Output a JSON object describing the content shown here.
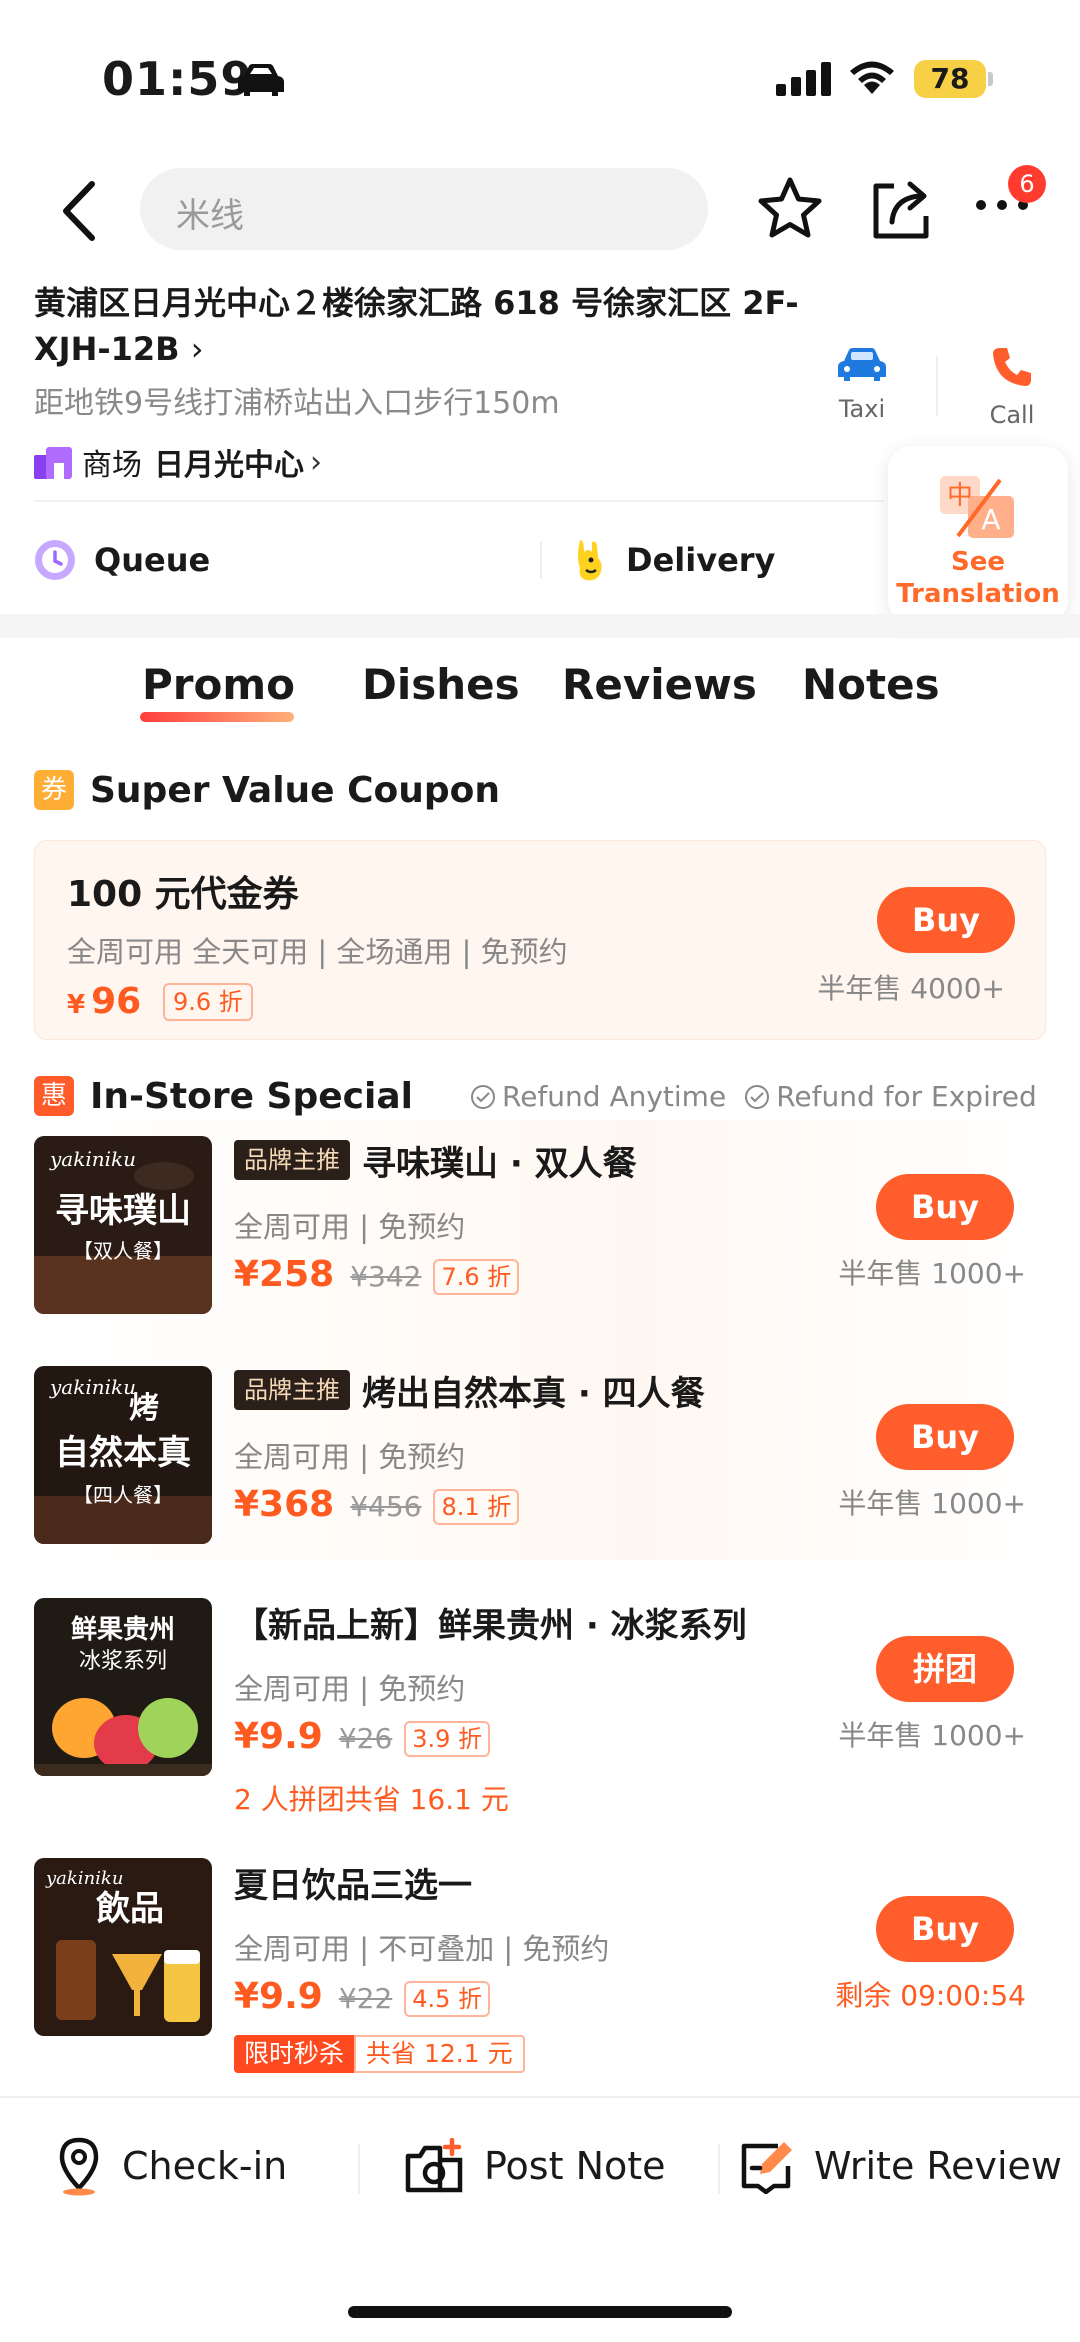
{
  "status_bar": {
    "time": "01:59",
    "battery": "78"
  },
  "search": {
    "placeholder": "米线"
  },
  "nav": {
    "badge_count": "6"
  },
  "address": {
    "text": "黄浦区日月光中心２楼徐家汇路 618 号徐家汇区 2F-XJH-12B",
    "chevron": "›",
    "metro": "距地铁9号线打浦桥站出入口步行150m"
  },
  "mall": {
    "type": "商场",
    "name": "日月光中心",
    "chevron": "›"
  },
  "contact": {
    "taxi": "Taxi",
    "call": "Call"
  },
  "translation": {
    "label": "See Translation"
  },
  "services": {
    "queue": "Queue",
    "delivery": "Delivery"
  },
  "tabs": [
    "Promo",
    "Dishes",
    "Reviews",
    "Notes"
  ],
  "coupon_section": {
    "chip": "券",
    "title": "Super Value Coupon",
    "card": {
      "title": "100 元代金券",
      "tags": "全周可用  全天可用 | 全场通用 | 免预约",
      "yen": "¥",
      "price": "96",
      "discount": "9.6 折",
      "buy": "Buy",
      "sold": "半年售 4000+"
    }
  },
  "store_section": {
    "chip": "惠",
    "title": "In-Store Special",
    "refund_anytime": "Refund Anytime",
    "refund_expired": "Refund for Expired"
  },
  "items": [
    {
      "brand_tag": "品牌主推",
      "name": "寻味璞山 · 双人餐",
      "tags": "全周可用 | 免预约",
      "price": "¥258",
      "orig": "¥342",
      "discount": "7.6 折",
      "buy": "Buy",
      "sold": "半年售 1000+",
      "thumb_title": "寻味璞山",
      "thumb_sub": "【双人餐】",
      "thumb_brand": "yakiniku"
    },
    {
      "brand_tag": "品牌主推",
      "name": "烤出自然本真 · 四人餐",
      "tags": "全周可用 | 免预约",
      "price": "¥368",
      "orig": "¥456",
      "discount": "8.1 折",
      "buy": "Buy",
      "sold": "半年售 1000+",
      "thumb_title": "自然本真",
      "thumb_top": "烤",
      "thumb_sub": "【四人餐】",
      "thumb_brand": "yakiniku"
    },
    {
      "name": "【新品上新】鲜果贵州 · 冰浆系列",
      "tags": "全周可用 | 免预约",
      "price": "¥9.9",
      "orig": "¥26",
      "discount": "3.9 折",
      "buy": "拼团",
      "sold": "半年售 1000+",
      "extra": "2 人拼团共省 16.1 元",
      "thumb_title": "鲜果贵州",
      "thumb_sub": "冰浆系列"
    },
    {
      "name": "夏日饮品三选一",
      "tags": "全周可用 | 不可叠加 | 免预约",
      "price": "¥9.9",
      "orig": "¥22",
      "discount": "4.5 折",
      "buy": "Buy",
      "sold": "剩余 09:00:54",
      "flash": "限时秒杀",
      "save": "共省 12.1 元",
      "thumb_title": "飲品",
      "thumb_brand": "yakiniku"
    }
  ],
  "bottom_bar": {
    "checkin": "Check-in",
    "post_note": "Post Note",
    "write_review": "Write Review"
  },
  "colors": {
    "accent": "#ff5e2c",
    "price": "#ff5a1f",
    "coupon_chip": "#ffae35",
    "store_chip": "#ff5a2a"
  }
}
